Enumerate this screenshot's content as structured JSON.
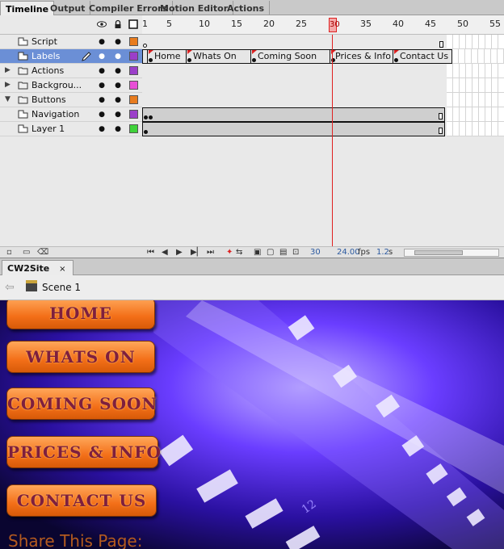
{
  "panel_tabs": [
    "Timeline",
    "Output",
    "Compiler Errors",
    "Motion Editor",
    "Actions"
  ],
  "timeline": {
    "ruler_ticks": [
      "1",
      "5",
      "10",
      "15",
      "20",
      "25",
      "30",
      "35",
      "40",
      "45",
      "50",
      "55"
    ],
    "current_frame": "30",
    "layers": [
      {
        "name": "Script",
        "type": "layer",
        "color": "#e87c1e"
      },
      {
        "name": "Labels",
        "type": "layer",
        "color": "#9b3fc9",
        "selected": true
      },
      {
        "name": "Actions",
        "type": "folder",
        "color": "#9b3fc9"
      },
      {
        "name": "Backgrou...",
        "type": "folder",
        "color": "#e84fd6"
      },
      {
        "name": "Buttons",
        "type": "folder-open",
        "color": "#e87c1e"
      },
      {
        "name": "Navigation",
        "type": "layer",
        "color": "#9b3fc9"
      },
      {
        "name": "Layer 1",
        "type": "layer",
        "color": "#3fd23a"
      }
    ],
    "frame_labels": [
      "Home",
      "Whats On",
      "Coming Soon",
      "Prices & Info",
      "Contact Us"
    ],
    "fps": "24.00",
    "fps_unit": "fps",
    "time": "1.2",
    "time_unit": "s",
    "frame_field": "30"
  },
  "document": {
    "tab_name": "CW2Site",
    "close_symbol": "×",
    "scene": "Scene 1"
  },
  "stage": {
    "nav_buttons": [
      "HOME",
      "WHATS ON",
      "COMING SOON",
      "PRICES & INFO",
      "CONTACT US"
    ],
    "share_text": "Share This Page:",
    "film_number": "12"
  },
  "icons": [
    "eye-icon",
    "lock-icon",
    "outline-icon",
    "pencil-icon",
    "folder-icon",
    "layer-icon",
    "scene-icon",
    "back-arrow-icon"
  ]
}
